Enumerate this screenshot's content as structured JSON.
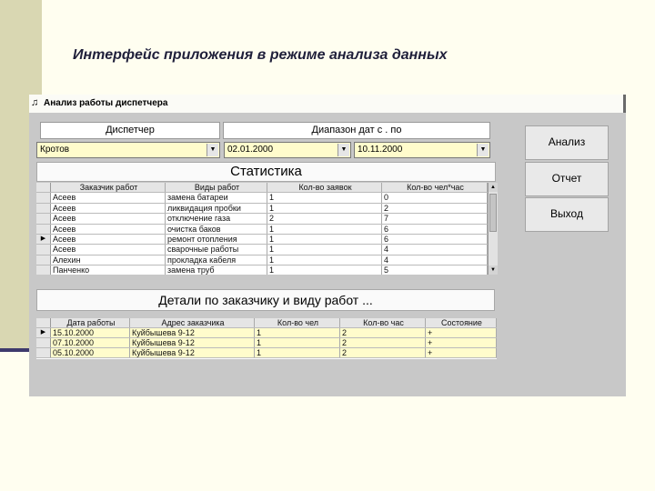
{
  "slide": {
    "title": "Интерфейс приложения в режиме анализа данных"
  },
  "window": {
    "title": "Анализ работы диспетчера",
    "icon": "window-icon"
  },
  "filters": {
    "dispatcher_label": "Диспетчер",
    "date_range_label": "Диапазон дат с . по",
    "dispatcher_value": "Кротов",
    "date_from": "02.01.2000",
    "date_to": "10.11.2000"
  },
  "buttons": {
    "analyze": "Анализ",
    "report": "Отчет",
    "exit": "Выход"
  },
  "stats": {
    "title": "Статистика",
    "columns": [
      "Заказчик работ",
      "Виды работ",
      "Кол-во заявок",
      "Кол-во чел*час"
    ],
    "rows": [
      [
        "Асеев",
        "замена батареи",
        "1",
        "0"
      ],
      [
        "Асеев",
        "ликвидация пробки",
        "1",
        "2"
      ],
      [
        "Асеев",
        "отключение газа",
        "2",
        "7"
      ],
      [
        "Асеев",
        "очистка баков",
        "1",
        "6"
      ],
      [
        "Асеев",
        "ремонт отопления",
        "1",
        "6"
      ],
      [
        "Асеев",
        "сварочные работы",
        "1",
        "4"
      ],
      [
        "Алехин",
        "прокладка кабеля",
        "1",
        "4"
      ],
      [
        "Панченко",
        "замена труб",
        "1",
        "5"
      ]
    ],
    "selected_row": 4
  },
  "details": {
    "title": "Детали по заказчику и виду работ ...",
    "columns": [
      "Дата работы",
      "Адрес заказчика",
      "Кол-во чел",
      "Кол-во час",
      "Состояние"
    ],
    "rows": [
      [
        "15.10.2000",
        "Куйбышева 9-12",
        "1",
        "2",
        "+"
      ],
      [
        "07.10.2000",
        "Куйбышева 9-12",
        "1",
        "2",
        "+"
      ],
      [
        "05.10.2000",
        "Куйбышева 9-12",
        "1",
        "2",
        "+"
      ]
    ]
  },
  "icons": {
    "row_pointer": "row-pointer-icon",
    "dropdown": "chevron-down-icon"
  }
}
